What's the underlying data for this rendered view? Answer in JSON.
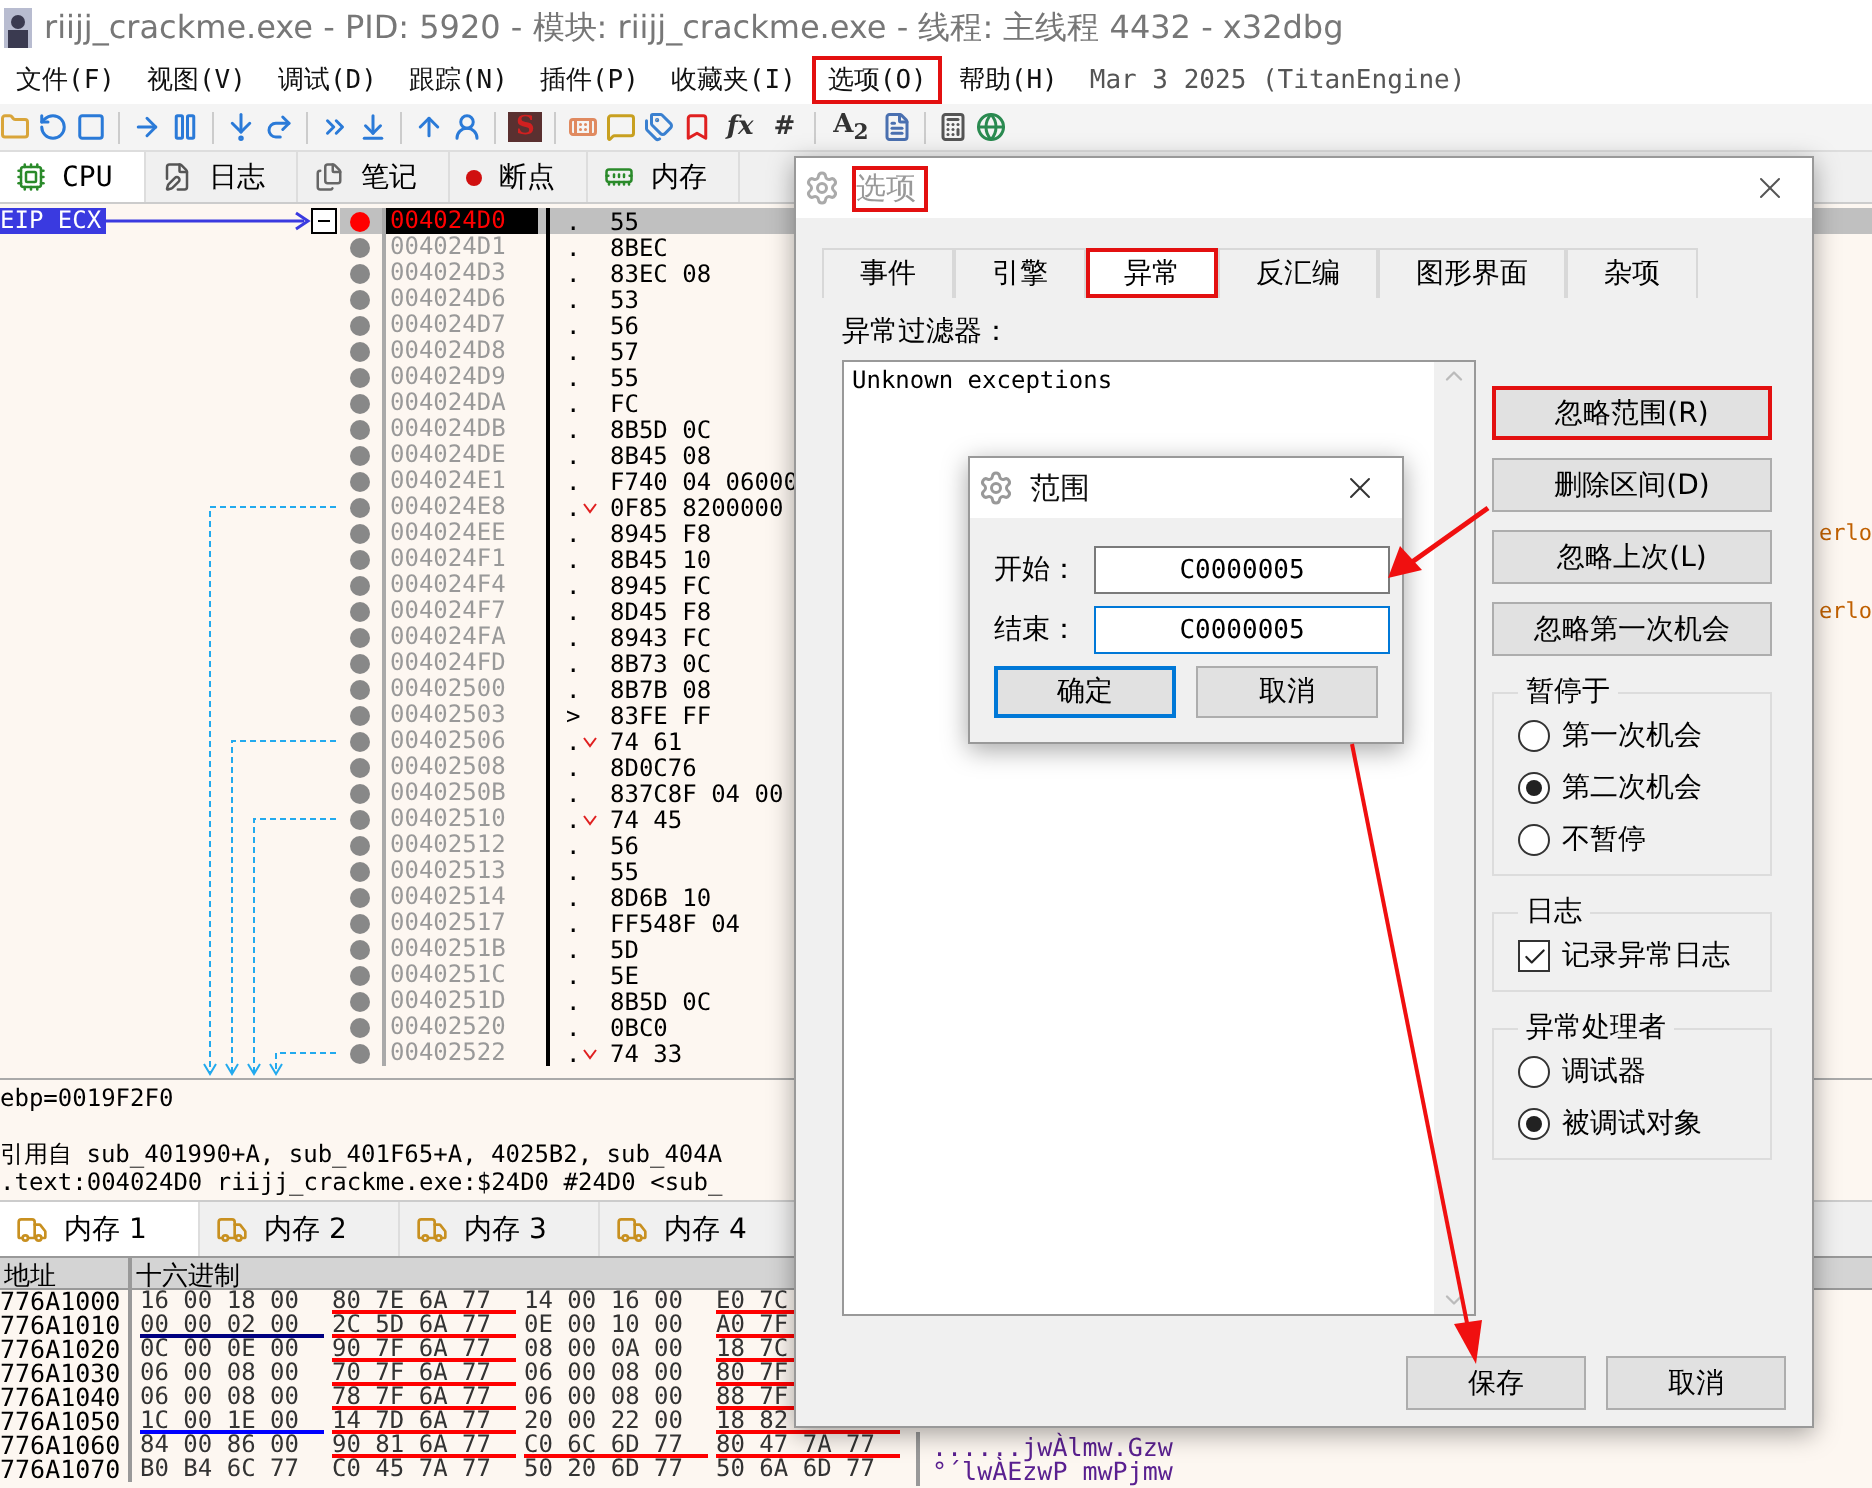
{
  "window": {
    "title": "riijj_crackme.exe - PID: 5920 - 模块: riijj_crackme.exe - 线程: 主线程 4432 - x32dbg"
  },
  "menu": [
    {
      "label": "文件(F)",
      "highlighted": false
    },
    {
      "label": "视图(V)",
      "highlighted": false
    },
    {
      "label": "调试(D)",
      "highlighted": false
    },
    {
      "label": "跟踪(N)",
      "highlighted": false
    },
    {
      "label": "插件(P)",
      "highlighted": false
    },
    {
      "label": "收藏夹(I)",
      "highlighted": false
    },
    {
      "label": "选项(O)",
      "highlighted": true
    },
    {
      "label": "帮助(H)",
      "highlighted": false
    }
  ],
  "build_info": "Mar 3 2025 (TitanEngine)",
  "toolbar": [
    {
      "kind": "icon"
    },
    {
      "kind": "icon"
    },
    {
      "kind": "icon"
    },
    {
      "kind": "separator"
    },
    {
      "kind": "icon"
    },
    {
      "kind": "icon"
    },
    {
      "kind": "separator"
    },
    {
      "kind": "icon"
    },
    {
      "kind": "icon"
    },
    {
      "kind": "separator"
    },
    {
      "kind": "icon"
    },
    {
      "kind": "icon"
    },
    {
      "kind": "separator"
    },
    {
      "kind": "icon"
    },
    {
      "kind": "icon"
    },
    {
      "kind": "separator"
    },
    {
      "kind": "badge",
      "text": "S"
    },
    {
      "kind": "separator"
    },
    {
      "kind": "icon"
    },
    {
      "kind": "icon"
    },
    {
      "kind": "icon"
    },
    {
      "kind": "icon"
    },
    {
      "kind": "glyph",
      "text": "*fx*"
    },
    {
      "kind": "glyph",
      "text": "#"
    },
    {
      "kind": "separator"
    },
    {
      "kind": "glyph",
      "text": "A$_{2}$"
    },
    {
      "kind": "icon"
    },
    {
      "kind": "separator"
    },
    {
      "kind": "icon"
    },
    {
      "kind": "icon"
    }
  ],
  "tabs": [
    {
      "label": "CPU",
      "selected": true
    },
    {
      "label": "日志",
      "selected": false
    },
    {
      "label": "笔记",
      "selected": false
    },
    {
      "label": "断点",
      "selected": false
    },
    {
      "label": "内存",
      "selected": false
    }
  ],
  "disassembly": {
    "register_label": "EIP ECX",
    "rows": [
      {
        "address": "004024D0",
        "marker": ".",
        "bytes": "55",
        "current": true,
        "jump": false
      },
      {
        "address": "004024D1",
        "marker": ".",
        "bytes": "8BEC",
        "current": false,
        "jump": false
      },
      {
        "address": "004024D3",
        "marker": ".",
        "bytes": "83EC 08",
        "current": false,
        "jump": false
      },
      {
        "address": "004024D6",
        "marker": ".",
        "bytes": "53",
        "current": false,
        "jump": false
      },
      {
        "address": "004024D7",
        "marker": ".",
        "bytes": "56",
        "current": false,
        "jump": false
      },
      {
        "address": "004024D8",
        "marker": ".",
        "bytes": "57",
        "current": false,
        "jump": false
      },
      {
        "address": "004024D9",
        "marker": ".",
        "bytes": "55",
        "current": false,
        "jump": false
      },
      {
        "address": "004024DA",
        "marker": ".",
        "bytes": "FC",
        "current": false,
        "jump": false
      },
      {
        "address": "004024DB",
        "marker": ".",
        "bytes": "8B5D 0C",
        "current": false,
        "jump": false
      },
      {
        "address": "004024DE",
        "marker": ".",
        "bytes": "8B45 08",
        "current": false,
        "jump": false
      },
      {
        "address": "004024E1",
        "marker": ".",
        "bytes": "F740 04 06000",
        "current": false,
        "jump": false
      },
      {
        "address": "004024E8",
        "marker": ".",
        "bytes": "0F85 8200000",
        "current": false,
        "jump": true
      },
      {
        "address": "004024EE",
        "marker": ".",
        "bytes": "8945 F8",
        "current": false,
        "jump": false,
        "comment": "erlo"
      },
      {
        "address": "004024F1",
        "marker": ".",
        "bytes": "8B45 10",
        "current": false,
        "jump": false
      },
      {
        "address": "004024F4",
        "marker": ".",
        "bytes": "8945 FC",
        "current": false,
        "jump": false
      },
      {
        "address": "004024F7",
        "marker": ".",
        "bytes": "8D45 F8",
        "current": false,
        "jump": false,
        "comment": "erlo"
      },
      {
        "address": "004024FA",
        "marker": ".",
        "bytes": "8943 FC",
        "current": false,
        "jump": false
      },
      {
        "address": "004024FD",
        "marker": ".",
        "bytes": "8B73 0C",
        "current": false,
        "jump": false
      },
      {
        "address": "00402500",
        "marker": ".",
        "bytes": "8B7B 08",
        "current": false,
        "jump": false
      },
      {
        "address": "00402503",
        "marker": ">",
        "bytes": "83FE FF",
        "current": false,
        "jump": false
      },
      {
        "address": "00402506",
        "marker": ".",
        "bytes": "74 61",
        "current": false,
        "jump": true
      },
      {
        "address": "00402508",
        "marker": ".",
        "bytes": "8D0C76",
        "current": false,
        "jump": false
      },
      {
        "address": "0040250B",
        "marker": ".",
        "bytes": "837C8F 04 00",
        "current": false,
        "jump": false
      },
      {
        "address": "00402510",
        "marker": ".",
        "bytes": "74 45",
        "current": false,
        "jump": true
      },
      {
        "address": "00402512",
        "marker": ".",
        "bytes": "56",
        "current": false,
        "jump": false
      },
      {
        "address": "00402513",
        "marker": ".",
        "bytes": "55",
        "current": false,
        "jump": false
      },
      {
        "address": "00402514",
        "marker": ".",
        "bytes": "8D6B 10",
        "current": false,
        "jump": false
      },
      {
        "address": "00402517",
        "marker": ".",
        "bytes": "FF548F 04",
        "current": false,
        "jump": false
      },
      {
        "address": "0040251B",
        "marker": ".",
        "bytes": "5D",
        "current": false,
        "jump": false
      },
      {
        "address": "0040251C",
        "marker": ".",
        "bytes": "5E",
        "current": false,
        "jump": false
      },
      {
        "address": "0040251D",
        "marker": ".",
        "bytes": "8B5D 0C",
        "current": false,
        "jump": false
      },
      {
        "address": "00402520",
        "marker": ".",
        "bytes": "0BC0",
        "current": false,
        "jump": false
      },
      {
        "address": "00402522",
        "marker": ".",
        "bytes": "74 33",
        "current": false,
        "jump": true
      }
    ]
  },
  "info_lines": [
    "ebp=0019F2F0",
    "引用自 sub_401990+A, sub_401F65+A, 4025B2, sub_404A",
    ".text:004024D0 riijj_crackme.exe:$24D0 #24D0 <sub_"
  ],
  "memory_tabs": [
    {
      "label": "内存 1",
      "selected": true
    },
    {
      "label": "内存 2",
      "selected": false
    },
    {
      "label": "内存 3",
      "selected": false
    },
    {
      "label": "内存 4",
      "selected": false
    }
  ],
  "hex_dump": {
    "columns": [
      "地址",
      "十六进制"
    ],
    "rows": [
      {
        "address": "776A1000",
        "groups": [
          {
            "bytes": "16 00 18 00"
          },
          {
            "bytes": "80 7E 6A 77",
            "color": "#ff0000"
          },
          {
            "bytes": "14 00 16 00"
          },
          {
            "bytes": "E0 7C",
            "color": "#ff0000"
          }
        ]
      },
      {
        "address": "776A1010",
        "groups": [
          {
            "bytes": "00 00 02 00",
            "color": "#000080"
          },
          {
            "bytes": "2C 5D 6A 77",
            "color": "#ff0000"
          },
          {
            "bytes": "0E 00 10 00"
          },
          {
            "bytes": "A0 7F",
            "color": "#ff0000"
          }
        ]
      },
      {
        "address": "776A1020",
        "groups": [
          {
            "bytes": "0C 00 0E 00"
          },
          {
            "bytes": "90 7F 6A 77",
            "color": "#ff0000"
          },
          {
            "bytes": "08 00 0A 00"
          },
          {
            "bytes": "18 7C",
            "color": "#ff0000"
          }
        ]
      },
      {
        "address": "776A1030",
        "groups": [
          {
            "bytes": "06 00 08 00"
          },
          {
            "bytes": "70 7F 6A 77",
            "color": "#ff0000"
          },
          {
            "bytes": "06 00 08 00"
          },
          {
            "bytes": "80 7F",
            "color": "#ff0000"
          }
        ]
      },
      {
        "address": "776A1040",
        "groups": [
          {
            "bytes": "06 00 08 00"
          },
          {
            "bytes": "78 7F 6A 77",
            "color": "#ff0000"
          },
          {
            "bytes": "06 00 08 00"
          },
          {
            "bytes": "88 7F",
            "color": "#ff0000"
          }
        ]
      },
      {
        "address": "776A1050",
        "groups": [
          {
            "bytes": "1C 00 1E 00",
            "color": "#0000ff"
          },
          {
            "bytes": "14 7D 6A 77",
            "color": "#ff0000"
          },
          {
            "bytes": "20 00 22 00"
          },
          {
            "bytes": "18 82",
            "color": "#ff0000"
          }
        ]
      },
      {
        "address": "776A1060",
        "groups": [
          {
            "bytes": "84 00 86 00"
          },
          {
            "bytes": "90 81 6A 77",
            "color": "#ff0000"
          },
          {
            "bytes": "C0 6C 6D 77",
            "color": "#ff0000"
          },
          {
            "bytes": "80 47 7A 77",
            "color": "#ff0000"
          }
        ],
        "ascii": "......jwÀlmw.Gzw"
      },
      {
        "address": "776A1070",
        "groups": [
          {
            "bytes": "B0 B4 6C 77"
          },
          {
            "bytes": "C0 45 7A 77"
          },
          {
            "bytes": "50 20 6D 77"
          },
          {
            "bytes": "50 6A 6D 77"
          }
        ],
        "ascii": "°´lwÀEzwP mwPjmw"
      }
    ]
  },
  "options_dialog": {
    "title": "选项",
    "title_highlighted": true,
    "tabs": [
      {
        "label": "事件",
        "selected": false,
        "highlighted": false
      },
      {
        "label": "引擎",
        "selected": false,
        "highlighted": false
      },
      {
        "label": "异常",
        "selected": true,
        "highlighted": true
      },
      {
        "label": "反汇编",
        "selected": false,
        "highlighted": false
      },
      {
        "label": "图形界面",
        "selected": false,
        "highlighted": false
      },
      {
        "label": "杂项",
        "selected": false,
        "highlighted": false
      }
    ],
    "filter_label": "异常过滤器：",
    "filter_items": [
      "Unknown exceptions"
    ],
    "buttons": [
      {
        "label": "忽略范围(R)",
        "highlighted": true
      },
      {
        "label": "删除区间(D)",
        "highlighted": false
      },
      {
        "label": "忽略上次(L)",
        "highlighted": false
      },
      {
        "label": "忽略第一次机会",
        "highlighted": false
      }
    ],
    "groups": [
      {
        "title": "暂停于",
        "kind": "radio",
        "options": [
          {
            "label": "第一次机会",
            "selected": false
          },
          {
            "label": "第二次机会",
            "selected": true
          },
          {
            "label": "不暂停",
            "selected": false
          }
        ]
      },
      {
        "title": "日志",
        "kind": "checkbox",
        "options": [
          {
            "label": "记录异常日志",
            "checked": true
          }
        ]
      },
      {
        "title": "异常处理者",
        "kind": "radio",
        "options": [
          {
            "label": "调试器",
            "selected": false
          },
          {
            "label": "被调试对象",
            "selected": true
          }
        ]
      }
    ],
    "footer_buttons": [
      "保存",
      "取消"
    ]
  },
  "range_dialog": {
    "title": "范围",
    "fields": [
      {
        "label": "开始：",
        "value": "C0000005",
        "focused": false
      },
      {
        "label": "结束：",
        "value": "C0000005",
        "focused": true
      }
    ],
    "buttons": [
      {
        "label": "确定",
        "default": true
      },
      {
        "label": "取消",
        "default": false
      }
    ]
  }
}
